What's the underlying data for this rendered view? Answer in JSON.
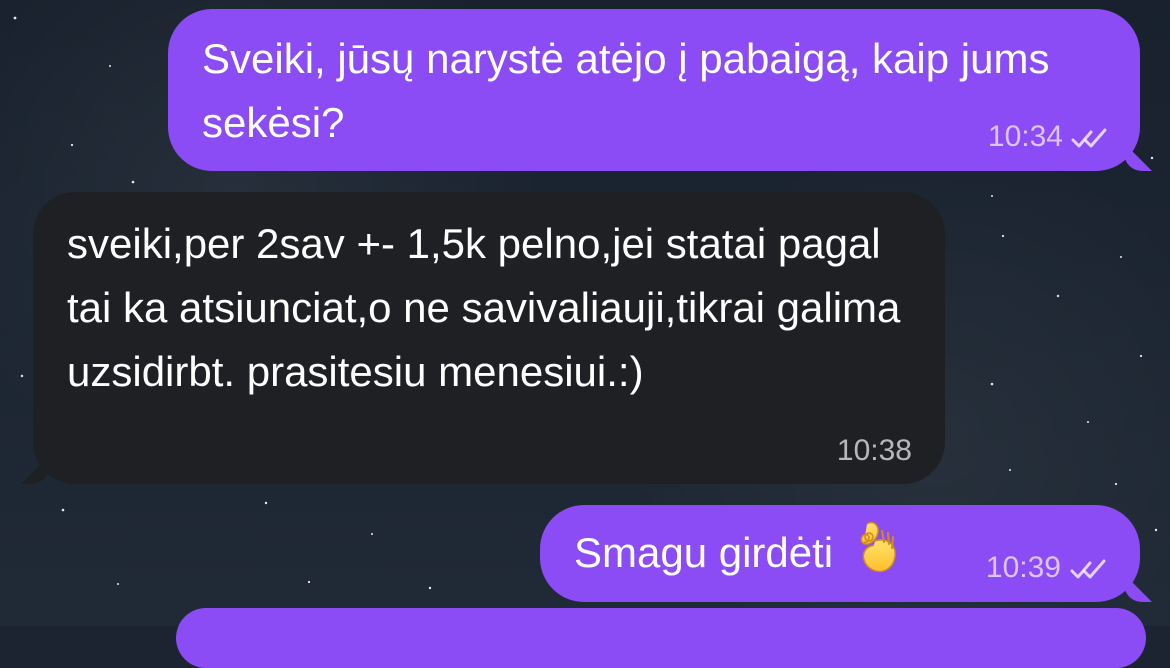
{
  "messages": [
    {
      "text": "Sveiki, jūsų narystė atėjo į pabaigą, kaip jums sekėsi?",
      "time": "10:34",
      "direction": "outgoing",
      "status": "read"
    },
    {
      "text": "sveiki,per 2sav +- 1,5k pelno,jei statai pagal tai ka atsiunciat,o ne savivaliauji,tikrai galima uzsidirbt. prasitesiu menesiui.:)",
      "time": "10:38",
      "direction": "incoming"
    },
    {
      "text": "Smagu girdėti",
      "time": "10:39",
      "direction": "outgoing",
      "status": "read",
      "emoji": "ok-hand-icon"
    }
  ],
  "colors": {
    "outgoing_bubble": "#8b4cf6",
    "incoming_bubble": "#1f2023",
    "background": "#1b2430"
  }
}
